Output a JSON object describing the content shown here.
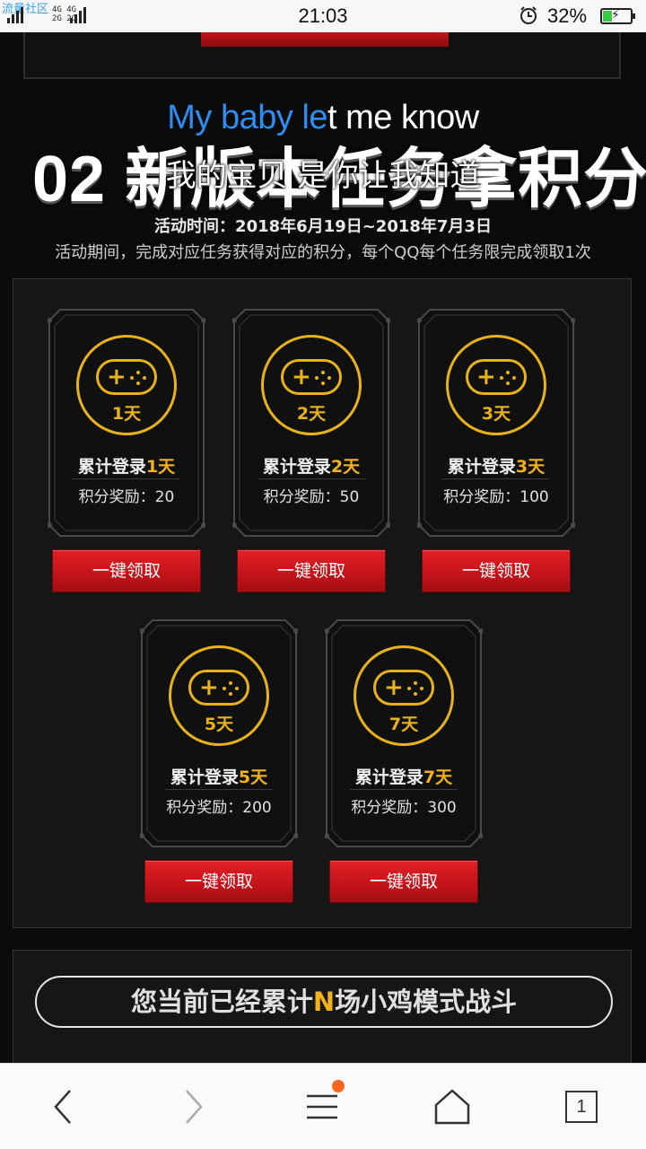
{
  "status_bar": {
    "watermark": "流量社区",
    "network_top": "4G 4G",
    "network_bottom": "2G 2G",
    "time": "21:03",
    "battery_percent": "32%",
    "battery_level": 0.32
  },
  "header": {
    "lyric_en_blue": "My baby le",
    "lyric_en_white": "t me know",
    "title": "02 新版本任务拿积分",
    "lyric_cn": "我的宝贝 是你让我知道",
    "date": "活动时间：2018年6月19日~2018年7月3日",
    "description": "活动期间，完成对应任务获得对应的积分，每个QQ每个任务限完成领取1次"
  },
  "cards": [
    {
      "day": "1天",
      "login_prefix": "累计登录",
      "login_num": "1天",
      "reward": "积分奖励：20",
      "button": "一键领取"
    },
    {
      "day": "2天",
      "login_prefix": "累计登录",
      "login_num": "2天",
      "reward": "积分奖励：50",
      "button": "一键领取"
    },
    {
      "day": "3天",
      "login_prefix": "累计登录",
      "login_num": "3天",
      "reward": "积分奖励：100",
      "button": "一键领取"
    },
    {
      "day": "5天",
      "login_prefix": "累计登录",
      "login_num": "5天",
      "reward": "积分奖励：200",
      "button": "一键领取"
    },
    {
      "day": "7天",
      "login_prefix": "累计登录",
      "login_num": "7天",
      "reward": "积分奖励：300",
      "button": "一键领取"
    }
  ],
  "battle": {
    "prefix": "您当前已经累计",
    "count": "N",
    "suffix": "场小鸡模式战斗"
  },
  "bottom_nav": {
    "back_icon": "chevron-left-icon",
    "forward_icon": "chevron-right-icon",
    "menu_icon": "hamburger-menu-icon",
    "home_icon": "home-icon",
    "tabs_count": "1",
    "notification_color": "#f5671e"
  },
  "colors": {
    "accent_gold": "#e8b21a",
    "button_red": "#c5141a",
    "link_blue": "#2f8cf0"
  }
}
